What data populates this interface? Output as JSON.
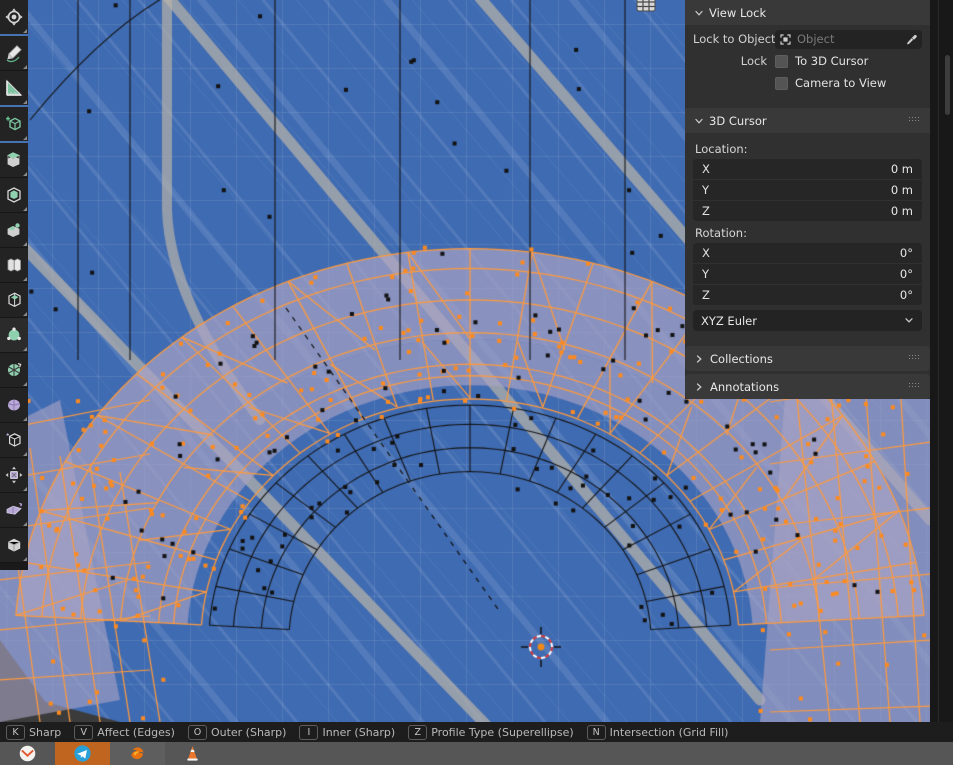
{
  "app": {
    "name": "Blender",
    "editor": "3D Viewport",
    "mode": "Edit Mode"
  },
  "toolbar": {
    "name": "Toolbar",
    "tools": [
      {
        "id": "tweak",
        "label": "Tweak",
        "icon": "tweak-icon",
        "active": false,
        "group_end": true
      },
      {
        "id": "annotate",
        "label": "Annotate",
        "icon": "annotate-pencil-icon",
        "active": false,
        "group_end": false
      },
      {
        "id": "measure",
        "label": "Measure",
        "icon": "measure-ruler-icon",
        "active": false,
        "group_end": true
      },
      {
        "id": "add-cube",
        "label": "Add Cube",
        "icon": "add-cube-icon",
        "active": false,
        "group_end": true
      },
      {
        "id": "extrude-region",
        "label": "Extrude Region",
        "icon": "extrude-region-icon",
        "active": false,
        "group_end": false
      },
      {
        "id": "inset-faces",
        "label": "Inset Faces",
        "icon": "inset-faces-icon",
        "active": false,
        "group_end": false
      },
      {
        "id": "bevel",
        "label": "Bevel",
        "icon": "bevel-icon",
        "active": false,
        "group_end": false
      },
      {
        "id": "loop-cut",
        "label": "Loop Cut",
        "icon": "loop-cut-icon",
        "active": false,
        "group_end": false
      },
      {
        "id": "knife",
        "label": "Knife",
        "icon": "knife-icon",
        "active": false,
        "group_end": false
      },
      {
        "id": "poly-build",
        "label": "Poly Build",
        "icon": "poly-build-icon",
        "active": true,
        "group_end": false
      },
      {
        "id": "spin",
        "label": "Spin",
        "icon": "spin-icon",
        "active": false,
        "group_end": false
      },
      {
        "id": "smooth",
        "label": "Smooth",
        "icon": "smooth-sphere-icon",
        "active": false,
        "group_end": false
      },
      {
        "id": "shear",
        "label": "Shear",
        "icon": "shear-icon",
        "active": false,
        "group_end": false
      },
      {
        "id": "transform",
        "label": "Transform",
        "icon": "transform-arrows-icon",
        "active": false,
        "group_end": false
      },
      {
        "id": "rip-region",
        "label": "Rip Region",
        "icon": "rip-region-icon",
        "active": false,
        "group_end": false
      },
      {
        "id": "shrink-fatten",
        "label": "Shrink/Fatten",
        "icon": "shrink-fatten-icon",
        "active": false,
        "group_end": false
      }
    ]
  },
  "sidebar": {
    "name": "View Sidebar",
    "view_lock": {
      "title": "View Lock",
      "expanded": true,
      "lock_to_object_label": "Lock to Object",
      "lock_to_object_placeholder": "Object",
      "lock_label": "Lock",
      "checkboxes": [
        {
          "label": "To 3D Cursor",
          "checked": false
        },
        {
          "label": "Camera to View",
          "checked": false
        }
      ]
    },
    "cursor_3d": {
      "title": "3D Cursor",
      "expanded": true,
      "location_label": "Location:",
      "location": [
        {
          "axis": "X",
          "value": "0 m"
        },
        {
          "axis": "Y",
          "value": "0 m"
        },
        {
          "axis": "Z",
          "value": "0 m"
        }
      ],
      "rotation_label": "Rotation:",
      "rotation": [
        {
          "axis": "X",
          "value": "0°"
        },
        {
          "axis": "Y",
          "value": "0°"
        },
        {
          "axis": "Z",
          "value": "0°"
        }
      ],
      "rotation_mode": "XYZ Euler"
    },
    "collapsed_panels": [
      {
        "title": "Collections",
        "expanded": false
      },
      {
        "title": "Annotations",
        "expanded": false
      }
    ]
  },
  "statusbar": {
    "name": "Status Bar",
    "keymap": [
      {
        "key": "K",
        "label": "Sharp"
      },
      {
        "key": "V",
        "label": "Affect (Edges)"
      },
      {
        "key": "O",
        "label": "Outer (Sharp)"
      },
      {
        "key": "I",
        "label": "Inner (Sharp)"
      },
      {
        "key": "Z",
        "label": "Profile Type (Superellipse)"
      },
      {
        "key": "N",
        "label": "Intersection (Grid Fill)"
      }
    ]
  },
  "taskbar": {
    "name": "System Taskbar",
    "items": [
      {
        "id": "thunderbird",
        "icon": "mail-icon",
        "state": "normal"
      },
      {
        "id": "telegram",
        "icon": "telegram-icon",
        "state": "active"
      },
      {
        "id": "firefox",
        "icon": "firefox-icon",
        "state": "hover"
      },
      {
        "id": "vlc",
        "icon": "cone-icon",
        "state": "normal"
      }
    ]
  },
  "viewport": {
    "name": "3D Viewport",
    "overlay_icon": "grid-snap-icon",
    "cursor_3d_marker": "3d-cursor-crosshair",
    "colors": {
      "background": "#3f6bb2",
      "selected_edge": "#ff9a3c",
      "face_fill": "#a9a3c4",
      "unselected_edge": "#141414",
      "vertex": "#121212",
      "active_vertex": "#ff8a1e",
      "panel_bg": "#303030",
      "header_bg": "#393939",
      "field_bg": "#232323",
      "statusbar_bg": "#1d1d1d",
      "taskbar_bg": "#565656",
      "taskbar_active": "#c0651f"
    }
  }
}
